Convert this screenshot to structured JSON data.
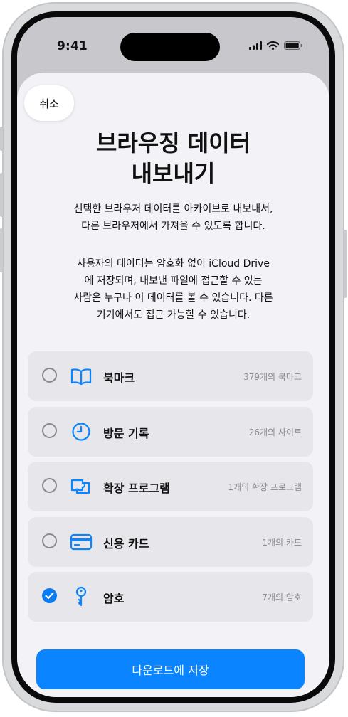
{
  "status_bar": {
    "time": "9:41"
  },
  "sheet": {
    "cancel_label": "취소",
    "title_lines": [
      "브라우징 데이터",
      "내보내기"
    ],
    "description1_lines": [
      "선택한 브라우저 데이터를 아카이브로 내보내서,",
      "다른 브라우저에서 가져올 수 있도록 합니다."
    ],
    "description2_lines": [
      "사용자의 데이터는 암호화 없이 iCloud Drive",
      "에 저장되며, 내보낸 파일에 접근할 수 있는",
      "사람은 누구나 이 데이터를 볼 수 있습니다. 다른",
      "기기에서도 접근 가능할 수 있습니다."
    ],
    "options": [
      {
        "label": "북마크",
        "count": "379개의 북마크",
        "icon": "book-icon",
        "checked": false
      },
      {
        "label": "방문 기록",
        "count": "26개의 사이트",
        "icon": "clock-icon",
        "checked": false
      },
      {
        "label": "확장 프로그램",
        "count": "1개의 확장 프로그램",
        "icon": "puzzle-icon",
        "checked": false
      },
      {
        "label": "신용 카드",
        "count": "1개의 카드",
        "icon": "credit-card-icon",
        "checked": false
      },
      {
        "label": "암호",
        "count": "7개의 암호",
        "icon": "key-icon",
        "checked": true
      }
    ],
    "save_label": "다운로드에 저장"
  },
  "colors": {
    "accent": "#0a84ff",
    "checkbox_checked": "#0a7cf2",
    "sheet_background": "#f2f2f7",
    "option_background": "#e6e6eb",
    "secondary_text": "#8a8a8e"
  }
}
